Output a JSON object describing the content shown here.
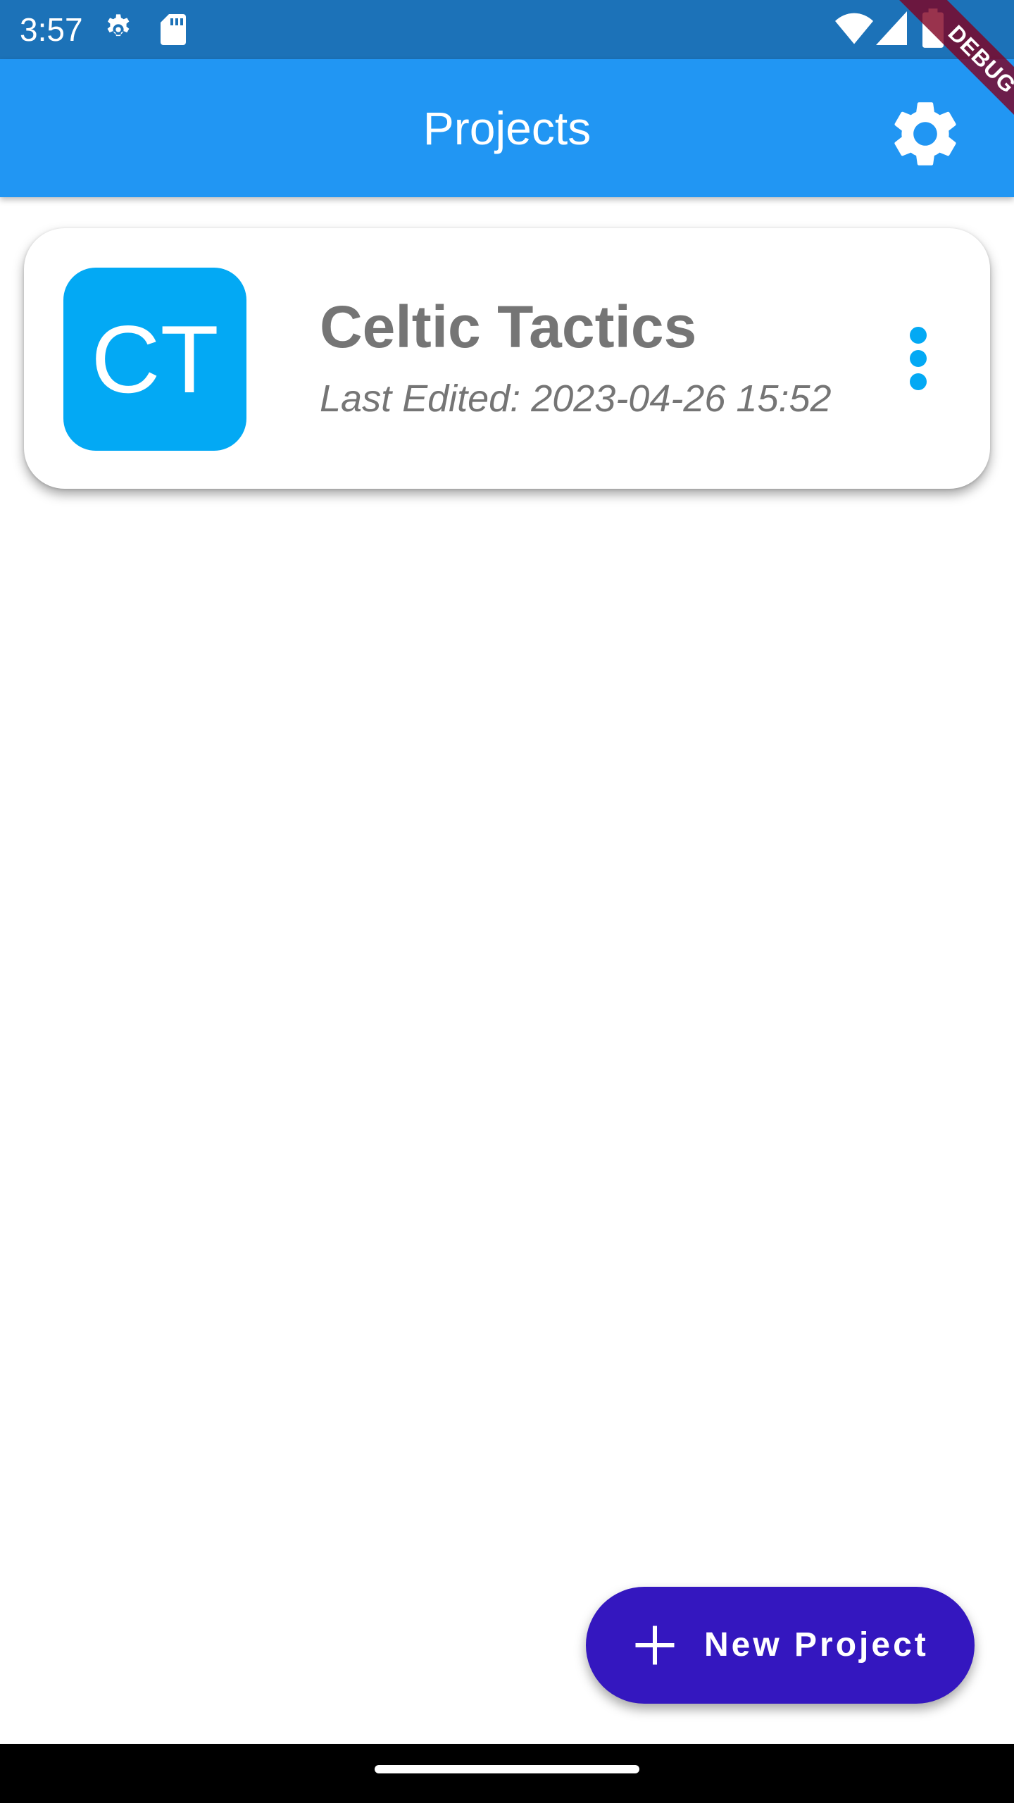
{
  "status_bar": {
    "time": "3:57",
    "icons": [
      "settings-gear-icon",
      "sd-card-icon",
      "wifi-icon",
      "cell-signal-icon",
      "battery-icon"
    ]
  },
  "app_bar": {
    "title": "Projects",
    "settings_icon": "gear-icon"
  },
  "debug_banner": {
    "label": "DEBUG"
  },
  "projects": [
    {
      "initials": "CT",
      "name": "Celtic Tactics",
      "last_edited": "Last Edited: 2023-04-26 15:52",
      "menu_icon": "more-vertical-icon"
    }
  ],
  "fab": {
    "icon": "plus-icon",
    "label": "New Project"
  },
  "colors": {
    "status_bar": "#1c72b8",
    "app_bar": "#2196f3",
    "avatar": "#03a9f4",
    "fab": "#3417bf",
    "card_text": "#757575"
  }
}
